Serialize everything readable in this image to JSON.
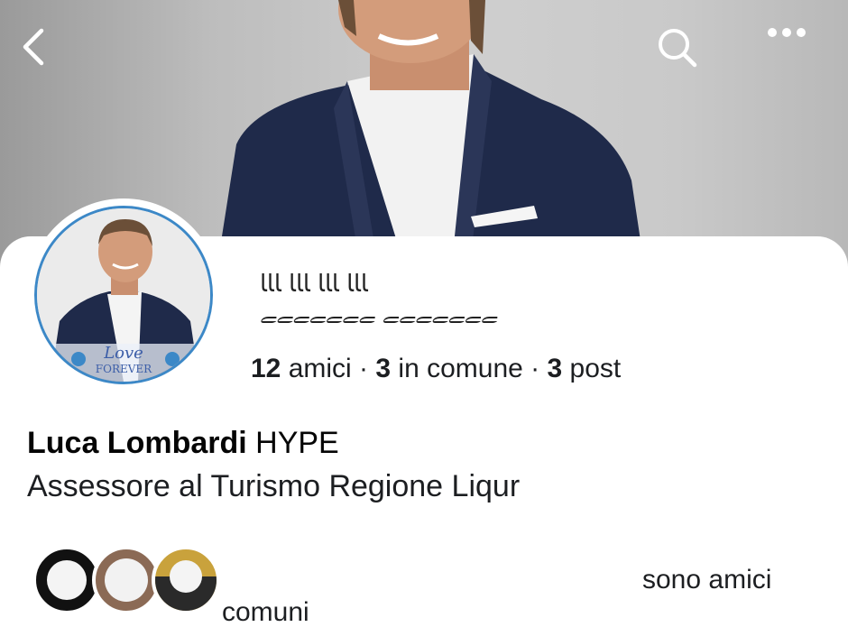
{
  "header": {
    "back_icon": "chevron-left-icon",
    "search_icon": "search-icon",
    "more_icon": "more-horizontal-icon"
  },
  "profile": {
    "display_name_styled": "ﺎﺎﺎ ﺎﺎﺎ  ﺎﺎﺎ ﺎﺎﺎ",
    "display_name_styled_line2": "ﮯﮯﮯﮯﮯﮯﮯ ﮯﮯﮯﮯﮯﮯﮯ",
    "stats": {
      "friends_count": "12",
      "friends_label": " amici · ",
      "mutual_count": "3",
      "mutual_label": " in comune · ",
      "posts_count": "3",
      "posts_label": " post"
    },
    "name": "Luca Lombardi",
    "name_suffix": " HYPE",
    "bio": "Assessore al Turismo Regione Liqur"
  },
  "mutual_friends": {
    "text": "sono amici",
    "text_cont": "comuni"
  },
  "colors": {
    "avatar_ring": "#3c88c7",
    "suit": "#1f2a4a"
  }
}
